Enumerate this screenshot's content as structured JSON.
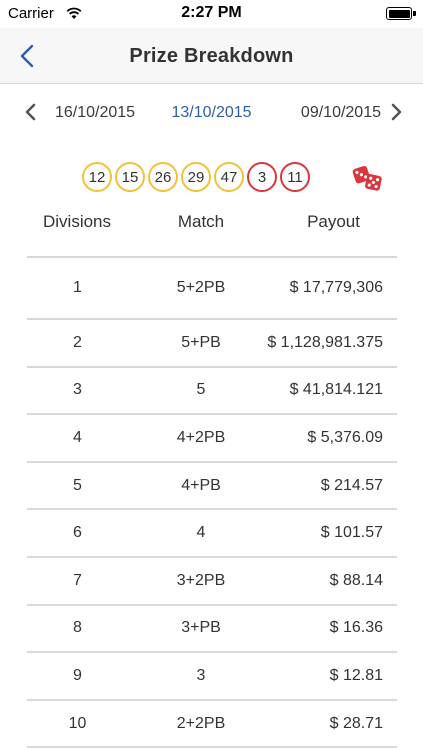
{
  "status_bar": {
    "carrier": "Carrier",
    "time": "2:27 PM"
  },
  "nav": {
    "title": "Prize Breakdown",
    "back_icon": "chevron-left-icon"
  },
  "date_selector": {
    "previous_date": "16/10/2015",
    "current_date": "13/10/2015",
    "next_date": "09/10/2015"
  },
  "draw": {
    "main_numbers": [
      "12",
      "15",
      "26",
      "29",
      "47"
    ],
    "powerball_numbers": [
      "3",
      "11"
    ],
    "main_ball_color": "#f0c23c",
    "powerball_color": "#d9363e",
    "accent_color": "#2f5ea8"
  },
  "table": {
    "headers": {
      "divisions": "Divisions",
      "match": "Match",
      "payout": "Payout"
    },
    "rows": [
      {
        "division": "1",
        "match": "5+2PB",
        "payout": "$ 17,779,306"
      },
      {
        "division": "2",
        "match": "5+PB",
        "payout": "$ 1,128,981.375"
      },
      {
        "division": "3",
        "match": "5",
        "payout": "$ 41,814.121"
      },
      {
        "division": "4",
        "match": "4+2PB",
        "payout": "$ 5,376.09"
      },
      {
        "division": "5",
        "match": "4+PB",
        "payout": "$ 214.57"
      },
      {
        "division": "6",
        "match": "4",
        "payout": "$ 101.57"
      },
      {
        "division": "7",
        "match": "3+2PB",
        "payout": "$ 88.14"
      },
      {
        "division": "8",
        "match": "3+PB",
        "payout": "$ 16.36"
      },
      {
        "division": "9",
        "match": "3",
        "payout": "$ 12.81"
      },
      {
        "division": "10",
        "match": "2+2PB",
        "payout": "$ 28.71"
      }
    ]
  }
}
